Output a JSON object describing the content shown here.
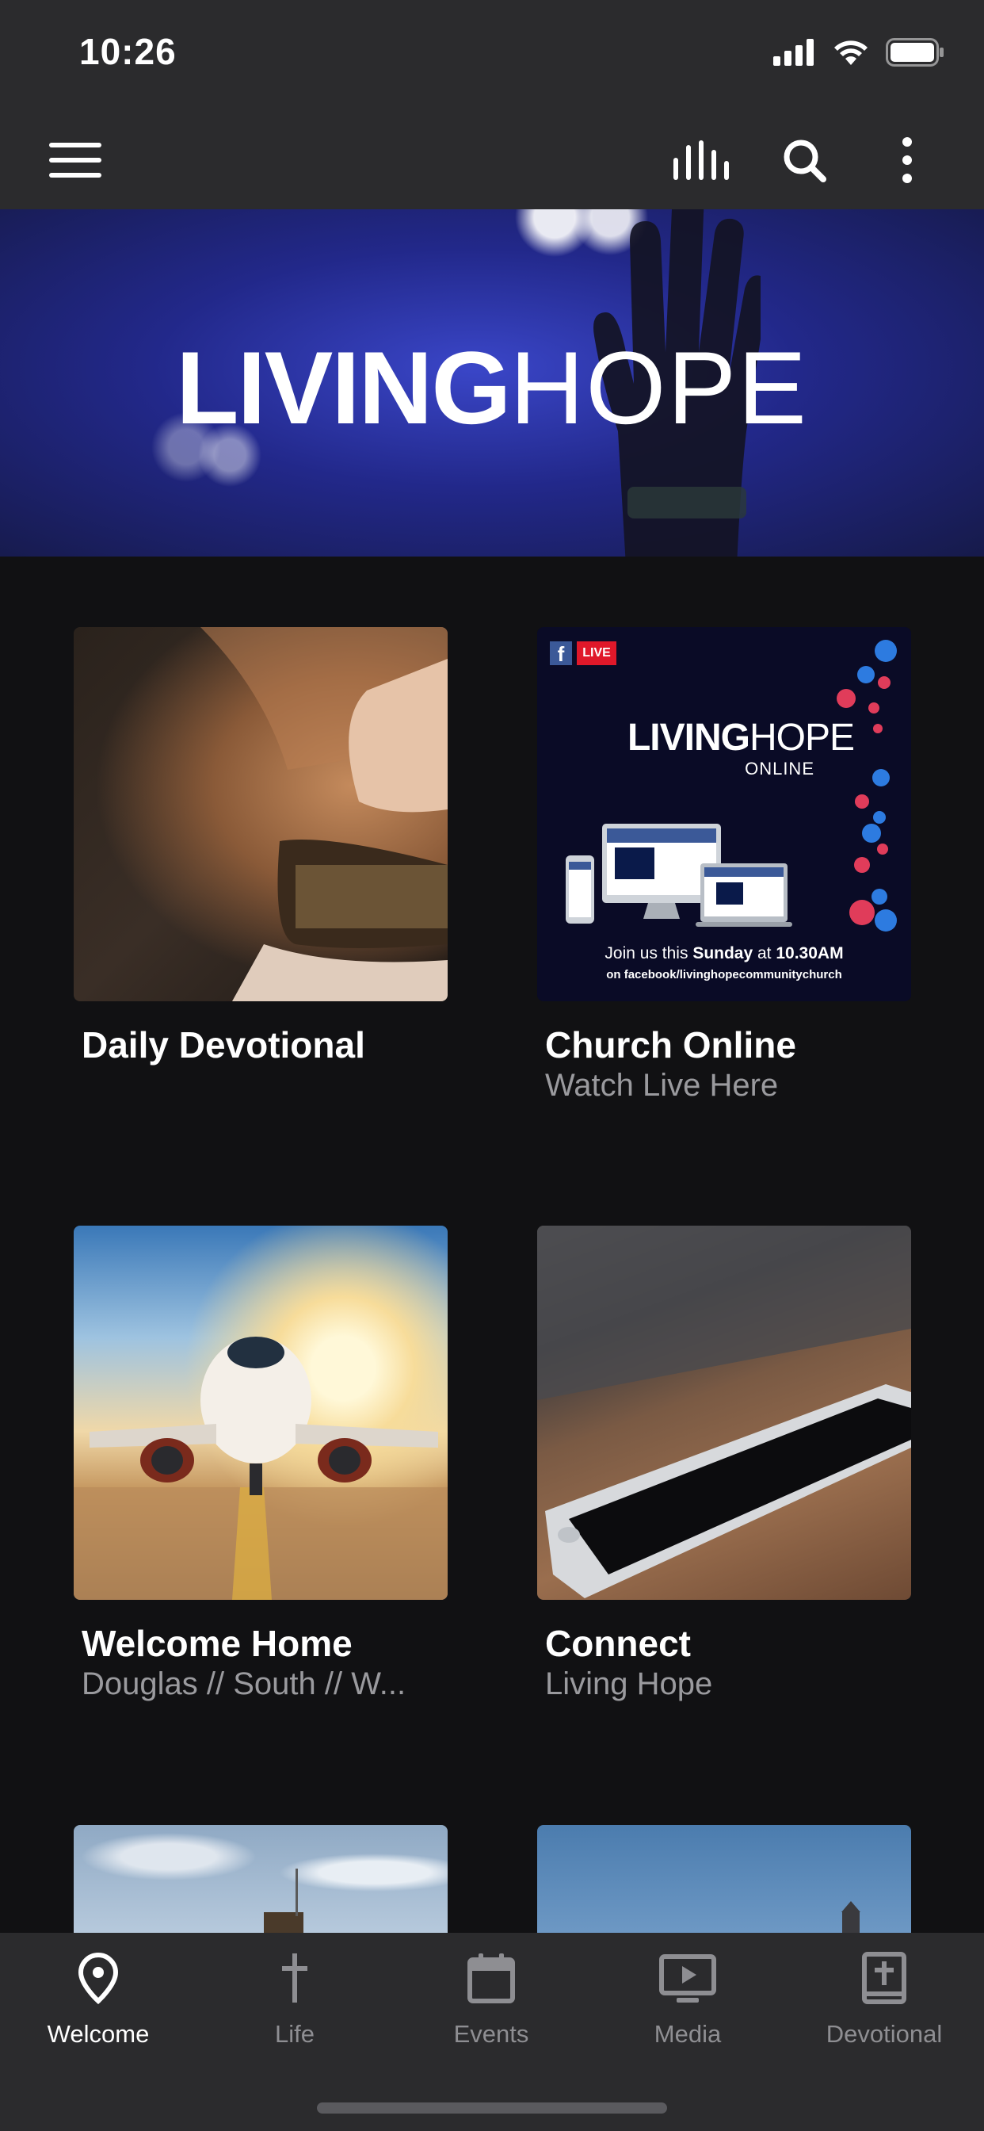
{
  "status_bar": {
    "time": "10:26"
  },
  "app_bar": {
    "menu_icon": "hamburger-icon",
    "actions": [
      "audio-bars-icon",
      "search-icon",
      "more-vertical-icon"
    ]
  },
  "hero": {
    "logo_bold": "LIVING",
    "logo_thin": "HOPE"
  },
  "cards": [
    {
      "title": "Daily Devotional",
      "subtitle": ""
    },
    {
      "title": "Church Online",
      "subtitle": "Watch Live Here",
      "poster": {
        "live_badge": "LIVE",
        "logo_bold": "LIVING",
        "logo_thin": "HOPE",
        "online": "ONLINE",
        "join_pre": "Join us this ",
        "join_day": "Sunday",
        "join_mid": " at ",
        "join_time": "10.30AM",
        "url": "on facebook/livinghopecommunitychurch"
      }
    },
    {
      "title": "Welcome Home",
      "subtitle": "Douglas // South // W..."
    },
    {
      "title": "Connect",
      "subtitle": "Living Hope"
    }
  ],
  "tab_bar": {
    "tabs": [
      {
        "label": "Welcome",
        "icon": "map-pin-icon",
        "active": true
      },
      {
        "label": "Life",
        "icon": "cross-icon",
        "active": false
      },
      {
        "label": "Events",
        "icon": "calendar-icon",
        "active": false
      },
      {
        "label": "Media",
        "icon": "play-screen-icon",
        "active": false
      },
      {
        "label": "Devotional",
        "icon": "bible-icon",
        "active": false
      }
    ]
  },
  "colors": {
    "background": "#111113",
    "bar": "#2b2b2d",
    "subtitle": "#9a9a9e",
    "inactive_tab": "#8e8e92"
  }
}
